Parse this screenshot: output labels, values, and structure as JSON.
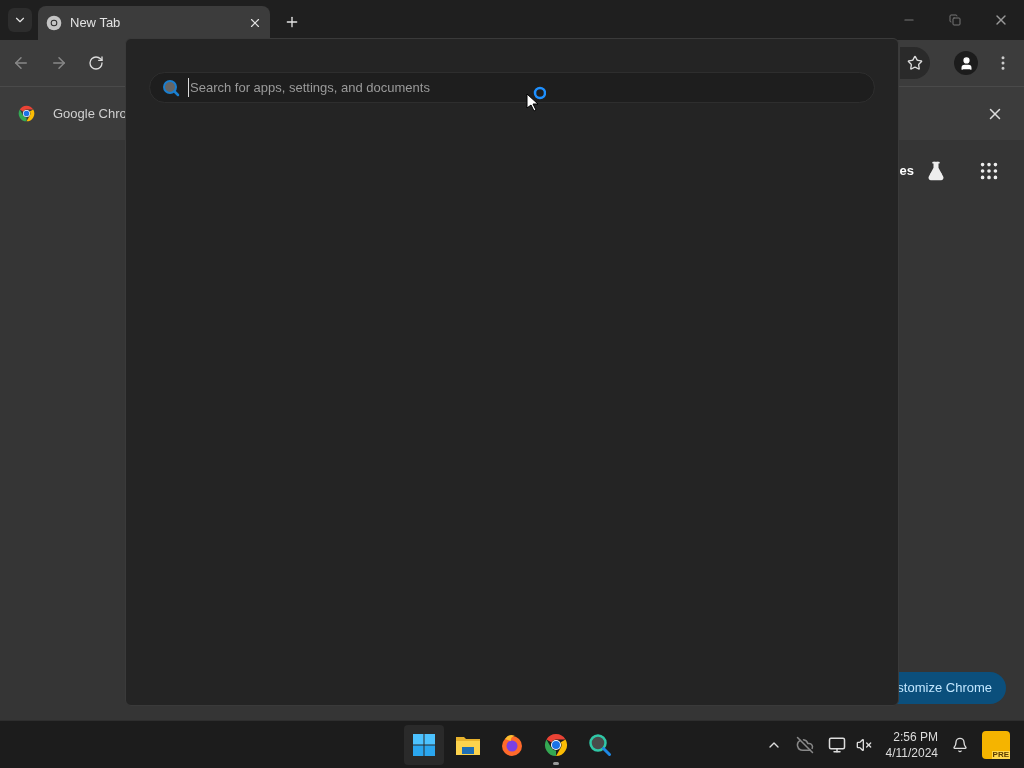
{
  "browser": {
    "tabs": [
      {
        "title": "New Tab",
        "selected": true
      }
    ],
    "infobar": {
      "text": "Google Chro"
    },
    "page": {
      "shortcut_link": "es",
      "customize_button": "stomize Chrome"
    }
  },
  "search_overlay": {
    "placeholder": "Search for apps, settings, and documents",
    "busy": true
  },
  "taskbar": {
    "apps": [
      {
        "kind": "start",
        "running": false
      },
      {
        "kind": "files",
        "running": false
      },
      {
        "kind": "firefox",
        "running": false
      },
      {
        "kind": "chrome",
        "running": true
      },
      {
        "kind": "search",
        "running": false
      }
    ],
    "clock": {
      "time": "2:56 PM",
      "date": "4/11/2024"
    },
    "tray_badge": "PRE"
  }
}
